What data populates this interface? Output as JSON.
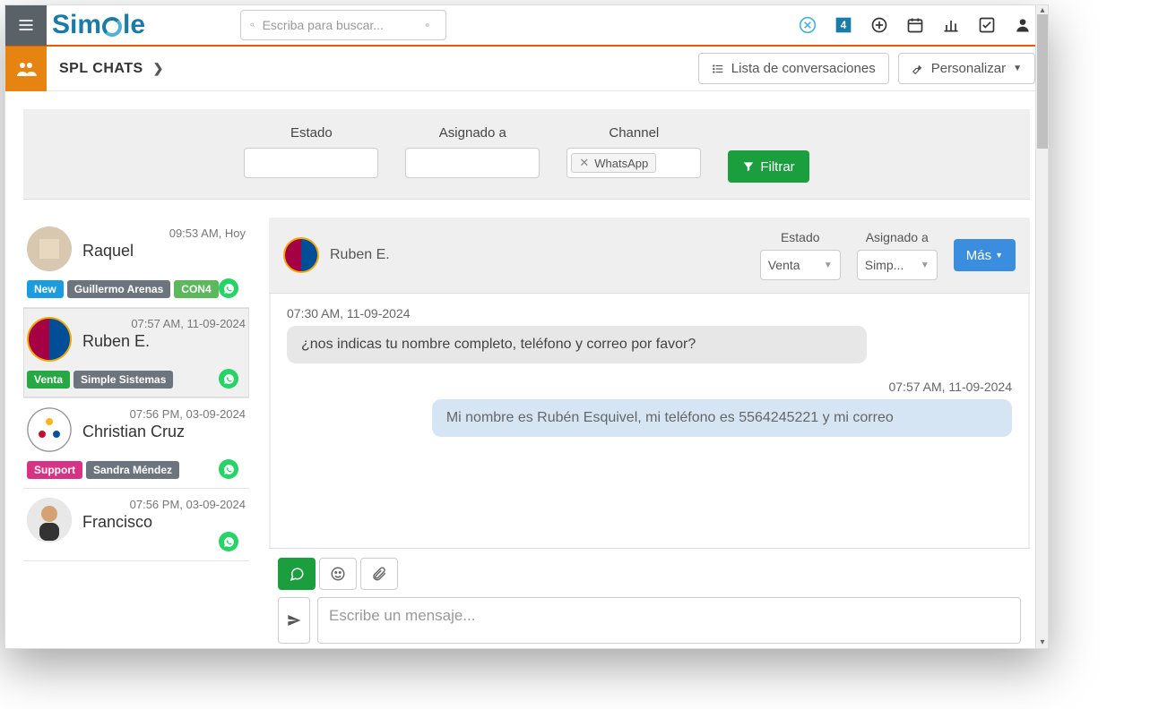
{
  "top": {
    "logo": "Simple",
    "search_placeholder": "Escriba para buscar..."
  },
  "subheader": {
    "title": "SPL CHATS",
    "btn_list": "Lista de conversaciones",
    "btn_customize": "Personalizar"
  },
  "filters": {
    "estado_label": "Estado",
    "asignado_label": "Asignado a",
    "channel_label": "Channel",
    "channel_chip": "WhatsApp",
    "filter_btn": "Filtrar"
  },
  "conversations": [
    {
      "time": "09:53 AM, Hoy",
      "name": "Raquel",
      "tags": [
        {
          "label": "New",
          "cls": "blue"
        },
        {
          "label": "Guillermo Arenas",
          "cls": "gray"
        },
        {
          "label": "CON4",
          "cls": "green2"
        }
      ],
      "avatar": "photo"
    },
    {
      "time": "07:57 AM, 11-09-2024",
      "name": "Ruben E.",
      "tags": [
        {
          "label": "Venta",
          "cls": "green3"
        },
        {
          "label": "Simple Sistemas",
          "cls": "gray"
        }
      ],
      "avatar": "barca",
      "active": true
    },
    {
      "time": "07:56 PM, 03-09-2024",
      "name": "Christian Cruz",
      "tags": [
        {
          "label": "Support",
          "cls": "pink"
        },
        {
          "label": "Sandra Méndez",
          "cls": "gray"
        }
      ],
      "avatar": "steelers"
    },
    {
      "time": "07:56 PM, 03-09-2024",
      "name": "Francisco",
      "tags": [],
      "avatar": "man"
    }
  ],
  "chat": {
    "header_name": "Ruben E.",
    "estado_label": "Estado",
    "estado_value": "Venta",
    "asignado_label": "Asignado a",
    "asignado_value": "Simp...",
    "more_btn": "Más",
    "messages": [
      {
        "time": "07:30 AM, 11-09-2024",
        "side": "left",
        "text": "¿nos indicas tu nombre completo, teléfono y correo por favor?"
      },
      {
        "time": "07:57 AM, 11-09-2024",
        "side": "right",
        "text": "Mi nombre es Rubén Esquivel, mi teléfono es 5564245221 y mi correo"
      }
    ],
    "compose_placeholder": "Escribe un mensaje..."
  }
}
